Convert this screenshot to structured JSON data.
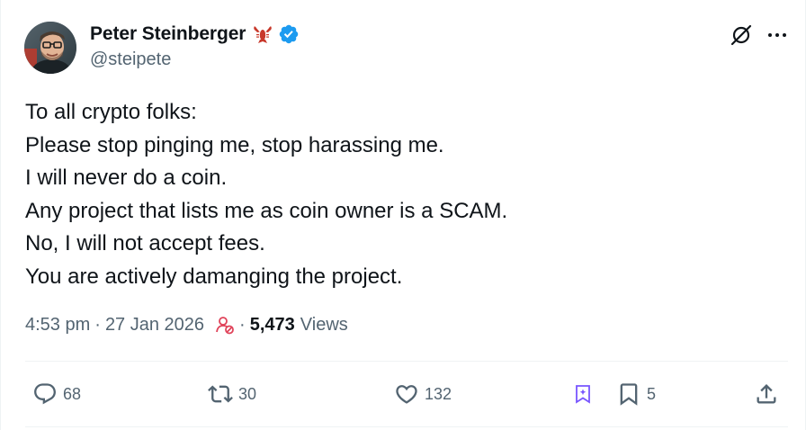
{
  "author": {
    "display_name": "Peter Steinberger",
    "handle": "@steipete",
    "icons": [
      "lobster-emoji",
      "verified-badge-icon"
    ]
  },
  "header_actions": [
    "grok-icon",
    "more-icon"
  ],
  "tweet": {
    "lines": [
      "To all crypto folks:",
      "Please stop pinging me, stop harassing me.",
      "I will never do a coin.",
      "Any project that lists me as coin owner is a SCAM.",
      "No, I will not accept fees.",
      "You are actively damanging the project."
    ]
  },
  "meta": {
    "time": "4:53 pm",
    "separator": "·",
    "date": "27 Jan 2026",
    "views_count": "5,473",
    "views_label": "Views"
  },
  "actions": {
    "replies": "68",
    "reposts": "30",
    "likes": "132",
    "bookmarks": "5"
  },
  "colors": {
    "text": "#0f1419",
    "secondary": "#536471",
    "verified": "#1d9bf0",
    "lobster": "#c8382b",
    "audience_icon": "#e0435a",
    "bookmark_accent": "#7856ff",
    "divider": "#eff3f4"
  }
}
